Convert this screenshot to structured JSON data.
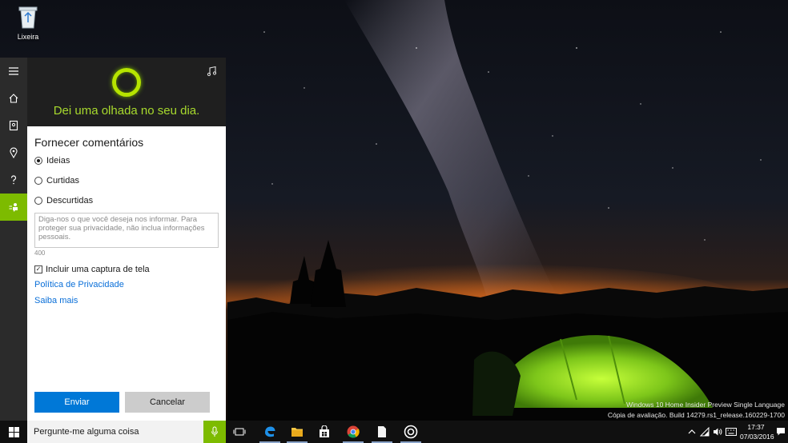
{
  "desktop": {
    "recycle_bin_label": "Lixeira",
    "watermark": {
      "line1": "Windows 10 Home Insider Preview Single Language",
      "line2": "Cópia de avaliação. Build 14279.rs1_release.160229-1700"
    }
  },
  "cortana": {
    "greeting": "Dei uma olhada no seu dia.",
    "accent_color": "#7dbb00",
    "sidebar": [
      {
        "name": "menu",
        "icon": "hamburger-icon"
      },
      {
        "name": "home",
        "icon": "home-icon"
      },
      {
        "name": "notebook",
        "icon": "notebook-icon"
      },
      {
        "name": "reminders",
        "icon": "lightbulb-pin-icon"
      },
      {
        "name": "help",
        "icon": "question-icon"
      },
      {
        "name": "feedback",
        "icon": "feedback-icon",
        "active": true
      }
    ],
    "feedback": {
      "title": "Fornecer comentários",
      "options": [
        {
          "label": "Ideias",
          "selected": true
        },
        {
          "label": "Curtidas",
          "selected": false
        },
        {
          "label": "Descurtidas",
          "selected": false
        }
      ],
      "textarea_placeholder": "Diga-nos o que você deseja nos informar. Para proteger sua privacidade, não inclua informações pessoais.",
      "char_limit": "400",
      "screenshot_checkbox": {
        "label": "Incluir uma captura de tela",
        "checked": true,
        "mark": "✓"
      },
      "privacy_link": "Política de Privacidade",
      "learn_more_link": "Saiba mais",
      "submit_label": "Enviar",
      "cancel_label": "Cancelar"
    }
  },
  "taskbar": {
    "search_placeholder": "Pergunte-me alguma coisa",
    "apps": [
      "task-view-icon",
      "edge-icon",
      "file-explorer-icon",
      "store-icon",
      "chrome-icon",
      "document-icon",
      "groove-icon"
    ],
    "tray_icons": [
      "chevron-up-icon",
      "network-icon",
      "volume-icon",
      "keyboard-icon"
    ],
    "clock": {
      "time": "17:37",
      "date": "07/03/2016"
    }
  }
}
